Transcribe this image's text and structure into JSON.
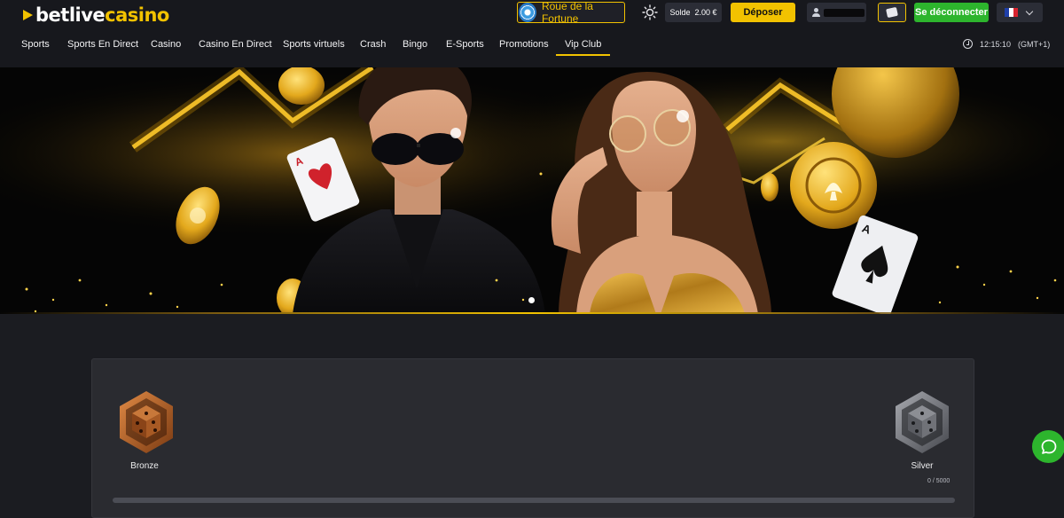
{
  "header": {
    "logo": {
      "part1": "betlive",
      "part2": "casino"
    },
    "wheel_button": "Roue de la Fortune",
    "balance": {
      "label": "Solde",
      "value": "2.00 €"
    },
    "deposit_button": "Déposer",
    "logout_button": "Se déconnecter",
    "language_flag": "fr",
    "colors": {
      "accent": "#f2c200",
      "logout": "#2db52d",
      "background": "#17181d"
    }
  },
  "nav": {
    "items": [
      {
        "label": "Sports"
      },
      {
        "label": "Sports En Direct"
      },
      {
        "label": "Casino"
      },
      {
        "label": "Casino En Direct"
      },
      {
        "label": "Sports virtuels"
      },
      {
        "label": "Crash"
      },
      {
        "label": "Bingo"
      },
      {
        "label": "E-Sports"
      },
      {
        "label": "Promotions"
      },
      {
        "label": "Vip Club",
        "active": true
      }
    ],
    "clock": {
      "time": "12:15:10",
      "timezone": "(GMT+1)"
    }
  },
  "banner": {
    "icon_names": [
      "gold-casino-chip",
      "playing-card-ace-hearts",
      "playing-card-ace-spades",
      "gold-coin"
    ],
    "carousel_dots": 1
  },
  "vip": {
    "current_tier": {
      "name": "Bronze",
      "icon": "bronze-dice-badge",
      "color": "#b8622a"
    },
    "next_tier": {
      "name": "Silver",
      "icon": "silver-dice-badge",
      "color": "#8a8c92"
    },
    "points": "0 / 5000",
    "progress_fraction": 0
  },
  "chat": {
    "icon": "chat-bubble-icon"
  }
}
